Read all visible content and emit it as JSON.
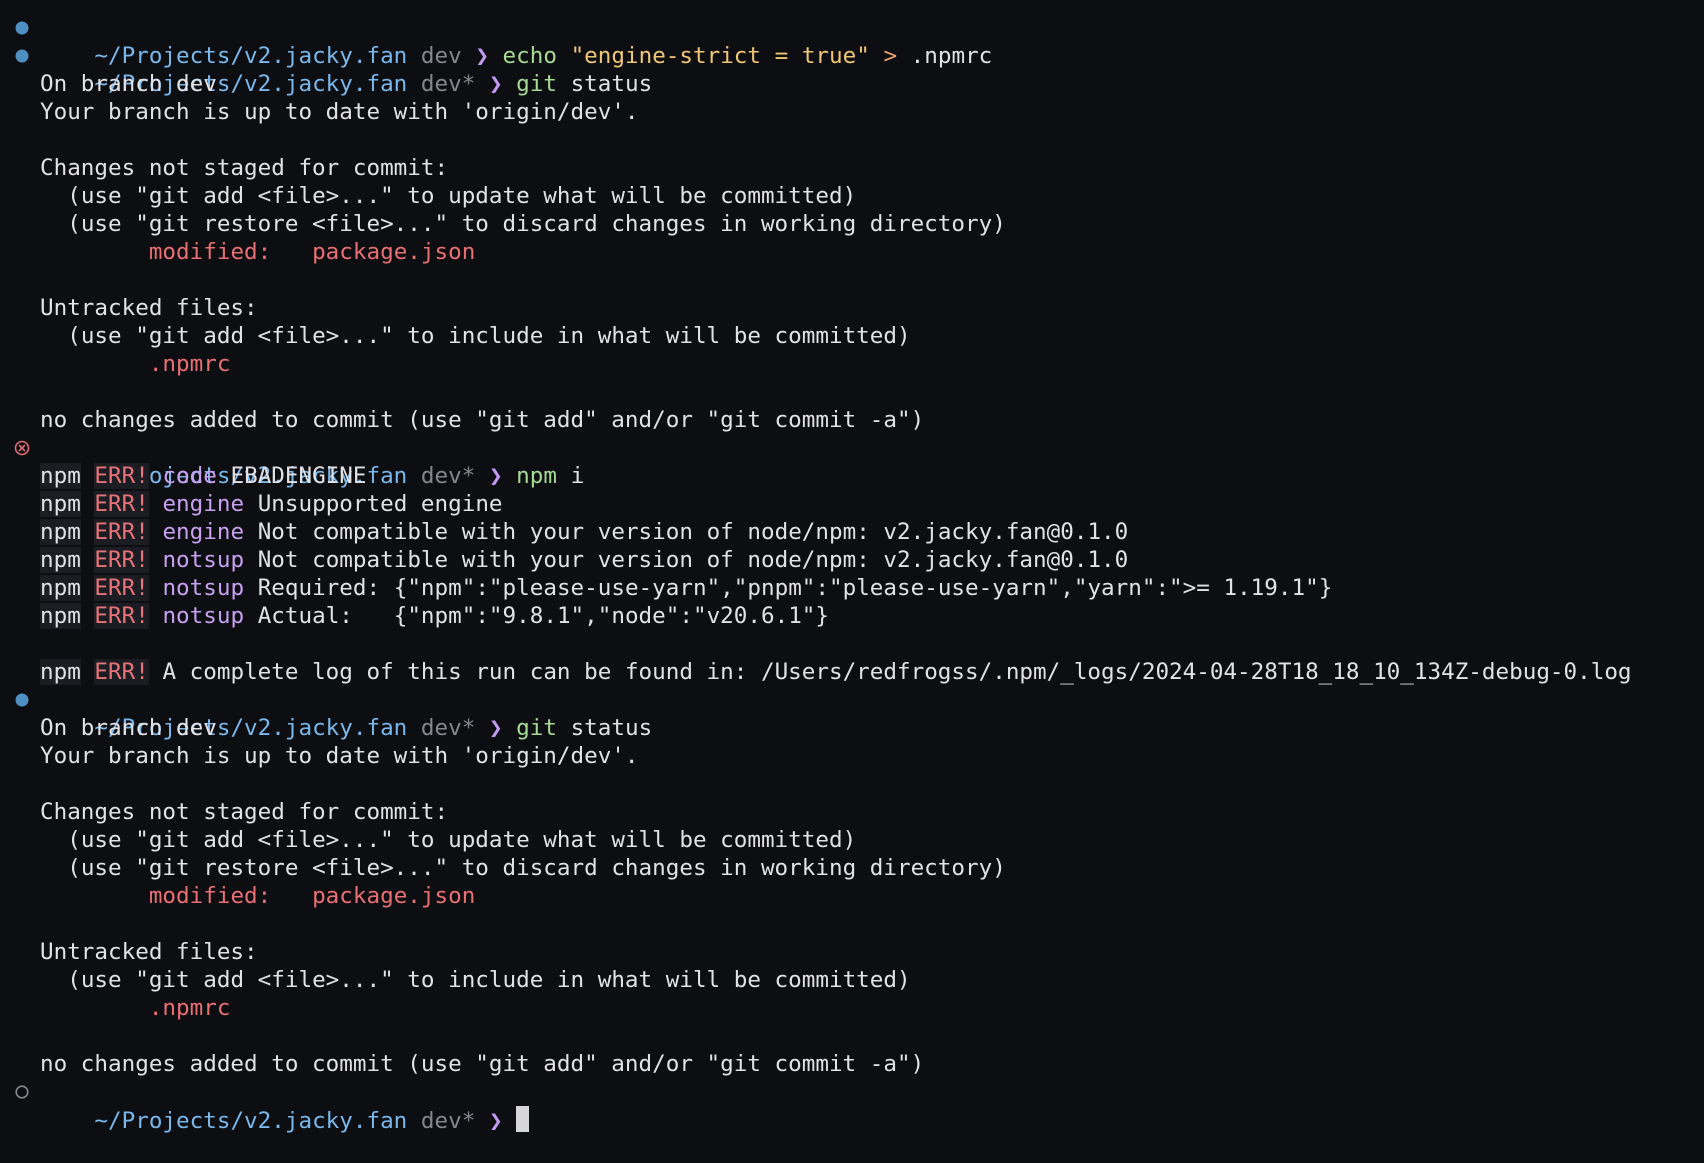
{
  "terminal": {
    "prompt": {
      "path": "~/Projects/v2.jacky.fan",
      "branch_clean": "dev",
      "branch_dirty": "dev*",
      "symbol": "❯"
    },
    "cmd1": {
      "command": "echo",
      "string": "\"engine-strict = true\"",
      "redirect": ">",
      "target": ".npmrc"
    },
    "git": {
      "command": "git",
      "args": "status"
    },
    "status": {
      "on_branch": "On branch dev",
      "up_to_date": "Your branch is up to date with 'origin/dev'.",
      "not_staged": "Changes not staged for commit:",
      "hint_add": "(use \"git add <file>...\" to update what will be committed)",
      "hint_restore": "(use \"git restore <file>...\" to discard changes in working directory)",
      "modified_label": "modified:",
      "modified_file": "package.json",
      "untracked": "Untracked files:",
      "hint_include": "(use \"git add <file>...\" to include in what will be committed)",
      "untracked_file": ".npmrc",
      "no_changes": "no changes added to commit (use \"git add\" and/or \"git commit -a\")"
    },
    "npm_cmd": {
      "command": "npm",
      "args": "i"
    },
    "npm_err": {
      "prefix": "npm",
      "err": "ERR!",
      "lines": [
        {
          "key": "code",
          "msg": "EBADENGINE"
        },
        {
          "key": "engine",
          "msg": "Unsupported engine"
        },
        {
          "key": "engine",
          "msg": "Not compatible with your version of node/npm: v2.jacky.fan@0.1.0"
        },
        {
          "key": "notsup",
          "msg": "Not compatible with your version of node/npm: v2.jacky.fan@0.1.0"
        },
        {
          "key": "notsup",
          "msg": "Required: {\"npm\":\"please-use-yarn\",\"pnpm\":\"please-use-yarn\",\"yarn\":\">= 1.19.1\"}"
        },
        {
          "key": "notsup",
          "msg": "Actual:   {\"npm\":\"9.8.1\",\"node\":\"v20.6.1\"}"
        }
      ],
      "log_line": "A complete log of this run can be found in: /Users/redfrogss/.npm/_logs/2024-04-28T18_18_10_134Z-debug-0.log"
    },
    "colors": {
      "background": "#0d0e12",
      "path": "#79b8ec",
      "branch": "#85878f",
      "arrow": "#c39aef",
      "command": "#a6da95",
      "string": "#f0c674",
      "error": "#e8737a",
      "success_dot": "#4f8fc2",
      "error_marker": "#e06c75"
    },
    "icons": {
      "success": "filled-circle-icon",
      "error": "circled-x-icon",
      "pending": "hollow-circle-icon"
    }
  }
}
